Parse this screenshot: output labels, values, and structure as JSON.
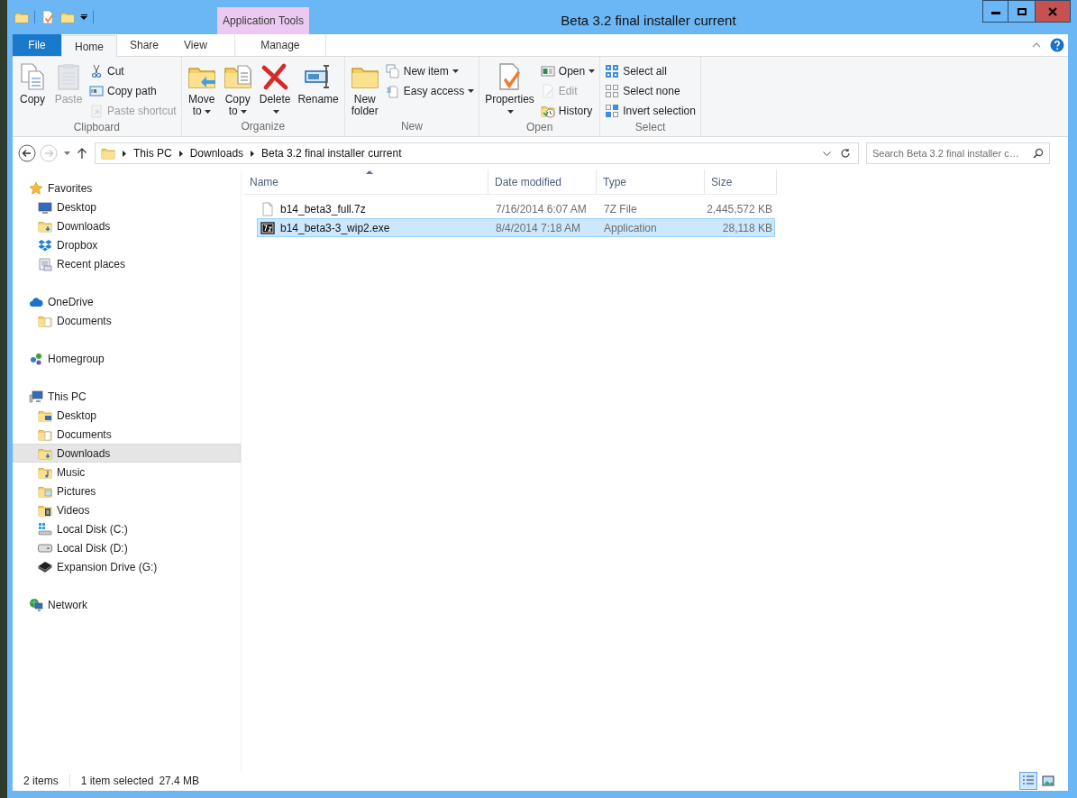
{
  "window": {
    "title": "Beta 3.2 final installer current"
  },
  "contextual_group": "Application Tools",
  "ribbon_tabs": [
    {
      "label": "File",
      "kind": "file",
      "selected": false
    },
    {
      "label": "Home",
      "kind": "normal",
      "selected": true
    },
    {
      "label": "Share",
      "kind": "normal",
      "selected": false
    },
    {
      "label": "View",
      "kind": "normal",
      "selected": false
    },
    {
      "label": "Manage",
      "kind": "contextual",
      "selected": false
    }
  ],
  "ribbon_groups": [
    {
      "label": "Clipboard",
      "items": [
        {
          "kind": "large",
          "label": "Copy",
          "disabled": false,
          "dropdown": false
        },
        {
          "kind": "large",
          "label": "Paste",
          "disabled": true,
          "dropdown": false
        },
        {
          "kind": "small",
          "label": "Cut",
          "disabled": false,
          "dropdown": false
        },
        {
          "kind": "small",
          "label": "Copy path",
          "disabled": false,
          "dropdown": false
        },
        {
          "kind": "small",
          "label": "Paste shortcut",
          "disabled": true,
          "dropdown": false
        }
      ]
    },
    {
      "label": "Organize",
      "items": [
        {
          "kind": "large",
          "label": "Move to",
          "disabled": false,
          "dropdown": true
        },
        {
          "kind": "large",
          "label": "Copy to",
          "disabled": false,
          "dropdown": true
        },
        {
          "kind": "large",
          "label": "Delete",
          "disabled": false,
          "dropdown": true
        },
        {
          "kind": "large",
          "label": "Rename",
          "disabled": false,
          "dropdown": false
        }
      ]
    },
    {
      "label": "New",
      "items": [
        {
          "kind": "large",
          "label": "New folder",
          "disabled": false,
          "dropdown": false
        },
        {
          "kind": "small",
          "label": "New item",
          "disabled": false,
          "dropdown": true
        },
        {
          "kind": "small",
          "label": "Easy access",
          "disabled": false,
          "dropdown": true
        }
      ]
    },
    {
      "label": "Open",
      "items": [
        {
          "kind": "large",
          "label": "Properties",
          "disabled": false,
          "dropdown": true
        },
        {
          "kind": "small",
          "label": "Open",
          "disabled": false,
          "dropdown": true
        },
        {
          "kind": "small",
          "label": "Edit",
          "disabled": true,
          "dropdown": false
        },
        {
          "kind": "small",
          "label": "History",
          "disabled": false,
          "dropdown": false
        }
      ]
    },
    {
      "label": "Select",
      "items": [
        {
          "kind": "small",
          "label": "Select all",
          "disabled": false,
          "dropdown": false
        },
        {
          "kind": "small",
          "label": "Select none",
          "disabled": false,
          "dropdown": false
        },
        {
          "kind": "small",
          "label": "Invert selection",
          "disabled": false,
          "dropdown": false
        }
      ]
    }
  ],
  "address_bar": {
    "breadcrumbs": [
      "This PC",
      "Downloads",
      "Beta 3.2 final installer current"
    ]
  },
  "search": {
    "placeholder": "Search Beta 3.2 final installer c…"
  },
  "nav_pane": [
    {
      "label": "Favorites",
      "selected": false,
      "children": [
        {
          "label": "Desktop",
          "selected": false
        },
        {
          "label": "Downloads",
          "selected": false
        },
        {
          "label": "Dropbox",
          "selected": false
        },
        {
          "label": "Recent places",
          "selected": false
        }
      ]
    },
    {
      "label": "OneDrive",
      "selected": false,
      "children": [
        {
          "label": "Documents",
          "selected": false
        }
      ]
    },
    {
      "label": "Homegroup",
      "selected": false
    },
    {
      "label": "This PC",
      "selected": false,
      "children": [
        {
          "label": "Desktop",
          "selected": false
        },
        {
          "label": "Documents",
          "selected": false
        },
        {
          "label": "Downloads",
          "selected": true
        },
        {
          "label": "Music",
          "selected": false
        },
        {
          "label": "Pictures",
          "selected": false
        },
        {
          "label": "Videos",
          "selected": false
        },
        {
          "label": "Local Disk (C:)",
          "selected": false
        },
        {
          "label": "Local Disk (D:)",
          "selected": false
        },
        {
          "label": "Expansion Drive (G:)",
          "selected": false
        }
      ]
    },
    {
      "label": "Network",
      "selected": false
    }
  ],
  "file_list": {
    "columns": [
      {
        "label": "Name",
        "sorted": true
      },
      {
        "label": "Date modified",
        "sorted": false
      },
      {
        "label": "Type",
        "sorted": false
      },
      {
        "label": "Size",
        "sorted": false
      }
    ],
    "rows": [
      {
        "name": "b14_beta3_full.7z",
        "date_modified": "7/16/2014 6:07 AM",
        "type": "7Z File",
        "size": "2,445,572 KB",
        "selected": false
      },
      {
        "name": "b14_beta3-3_wip2.exe",
        "date_modified": "8/4/2014 7:18 AM",
        "type": "Application",
        "size": "28,118 KB",
        "selected": true
      }
    ]
  },
  "status_bar": {
    "item_count": "2 items",
    "selection": "1 item selected",
    "selection_size": "27.4 MB"
  },
  "view_buttons": [
    {
      "selected": true
    },
    {
      "selected": false
    }
  ]
}
